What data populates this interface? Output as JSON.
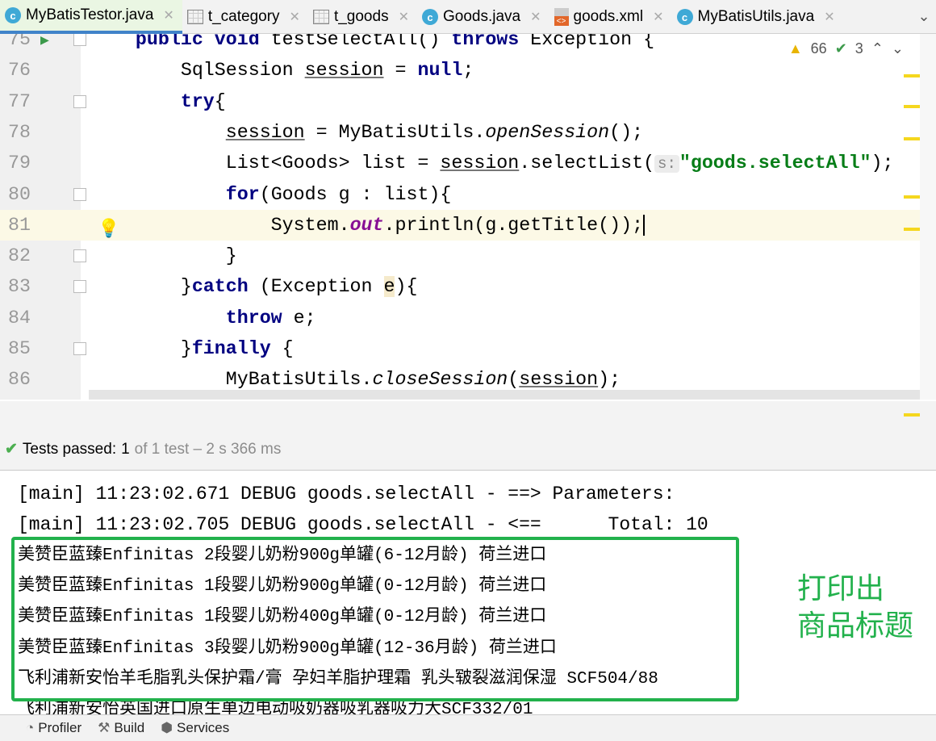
{
  "tabs": [
    {
      "label": "MyBatisTestor.java",
      "icon": "java-class-icon",
      "active": true
    },
    {
      "label": "t_category",
      "icon": "table-icon"
    },
    {
      "label": "t_goods",
      "icon": "table-icon"
    },
    {
      "label": "Goods.java",
      "icon": "java-class-icon"
    },
    {
      "label": "goods.xml",
      "icon": "xml-file-icon"
    },
    {
      "label": "MyBatisUtils.java",
      "icon": "java-class-icon"
    }
  ],
  "inspections": {
    "warnings": "66",
    "weak_warnings": "3"
  },
  "code_lines": [
    {
      "n": "75",
      "tokens": [
        [
          "    "
        ],
        [
          "public",
          "kw"
        ],
        [
          " "
        ],
        [
          "void",
          "kw"
        ],
        [
          " testSelectAll() "
        ],
        [
          "throws",
          "kw"
        ],
        [
          " Exception {"
        ]
      ]
    },
    {
      "n": "76",
      "tokens": [
        [
          "        SqlSession "
        ],
        [
          "session",
          "ul"
        ],
        [
          " = "
        ],
        [
          "null",
          "kw"
        ],
        [
          ";"
        ]
      ]
    },
    {
      "n": "77",
      "tokens": [
        [
          "        "
        ],
        [
          "try",
          "kw"
        ],
        [
          "{"
        ]
      ]
    },
    {
      "n": "78",
      "tokens": [
        [
          "            "
        ],
        [
          "session",
          "ul"
        ],
        [
          " = MyBatisUtils."
        ],
        [
          "openSession",
          "it"
        ],
        [
          "();"
        ]
      ]
    },
    {
      "n": "79",
      "tokens": [
        [
          "            List<Goods> list = "
        ],
        [
          "session",
          "ul"
        ],
        [
          ".selectList("
        ],
        [
          "s:",
          "hint"
        ],
        [
          "\"goods.selectAll\"",
          "str"
        ],
        [
          ");"
        ]
      ]
    },
    {
      "n": "80",
      "tokens": [
        [
          "            "
        ],
        [
          "for",
          "kw"
        ],
        [
          "(Goods g : list){"
        ]
      ]
    },
    {
      "n": "81",
      "tokens": [
        [
          "                System."
        ],
        [
          "out",
          "fld"
        ],
        [
          ".println(g.getTitle());"
        ],
        [
          "",
          "caret"
        ]
      ]
    },
    {
      "n": "82",
      "tokens": [
        [
          "            }"
        ]
      ]
    },
    {
      "n": "83",
      "tokens": [
        [
          "        }"
        ],
        [
          "catch",
          "kw"
        ],
        [
          " (Exception "
        ],
        [
          "e",
          "hl"
        ],
        [
          "){"
        ]
      ]
    },
    {
      "n": "84",
      "tokens": [
        [
          "            "
        ],
        [
          "throw",
          "kw"
        ],
        [
          " e;"
        ]
      ]
    },
    {
      "n": "85",
      "tokens": [
        [
          "        }"
        ],
        [
          "finally",
          "kw"
        ],
        [
          " {"
        ]
      ]
    },
    {
      "n": "86",
      "tokens": [
        [
          "            MyBatisUtils."
        ],
        [
          "closeSession",
          "it"
        ],
        [
          "("
        ],
        [
          "session",
          "ul"
        ],
        [
          ");"
        ]
      ]
    }
  ],
  "tests": {
    "passed_label": "Tests passed:",
    "passed": "1",
    "detail": "of 1 test – 2 s 366 ms"
  },
  "console_lines": [
    "[main] 11:23:02.671 DEBUG goods.selectAll - ==> Parameters: ",
    "[main] 11:23:02.705 DEBUG goods.selectAll - <==      Total: 10",
    "美赞臣蓝臻Enfinitas 2段婴儿奶粉900g单罐(6-12月龄) 荷兰进口",
    "美赞臣蓝臻Enfinitas 1段婴儿奶粉900g单罐(0-12月龄) 荷兰进口",
    "美赞臣蓝臻Enfinitas 1段婴儿奶粉400g单罐(0-12月龄) 荷兰进口",
    "美赞臣蓝臻Enfinitas 3段婴儿奶粉900g单罐(12-36月龄) 荷兰进口",
    "飞利浦新安怡羊毛脂乳头保护霜/膏 孕妇羊脂护理霜 乳头皲裂滋润保湿 SCF504/88",
    "飞利浦新安怡英国进口原生单边电动吸奶器吸乳器吸力大SCF332/01"
  ],
  "annotation": [
    "打印出",
    "商品标题"
  ],
  "bottom_tools": [
    {
      "label": "Profiler",
      "icon": "profiler-icon"
    },
    {
      "label": "Build",
      "icon": "hammer-icon"
    },
    {
      "label": "Services",
      "icon": "services-icon"
    }
  ],
  "colors": {
    "annotation": "#22b14c",
    "keyword": "#000080",
    "string": "#067d17"
  }
}
